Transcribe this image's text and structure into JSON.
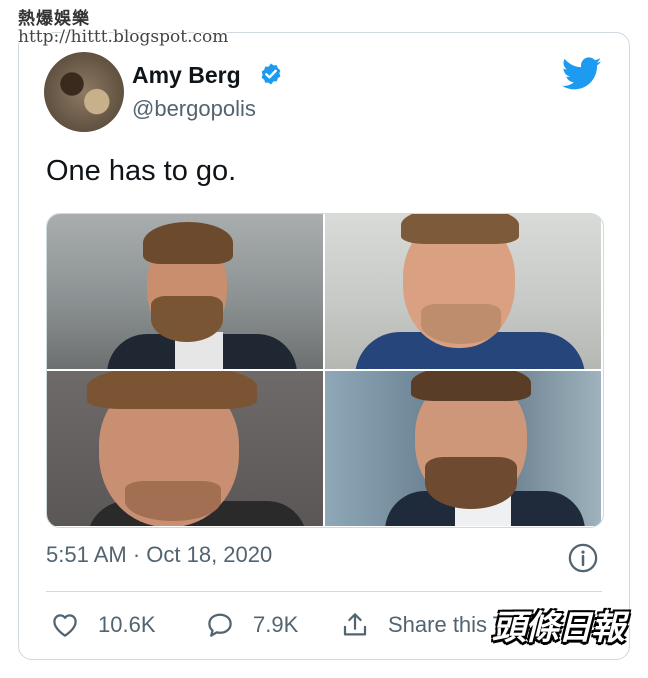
{
  "watermark": {
    "site_name": "熱爆娛樂",
    "site_url": "http://hittt.blogspot.com",
    "newspaper": "頭條日報"
  },
  "tweet": {
    "author_name": "Amy Berg",
    "handle": "@bergopolis",
    "text": "One has to go.",
    "timestamp": "5:51 AM · Oct 18, 2020",
    "verified": true,
    "accent_color": "#1d9bf0"
  },
  "actions": {
    "likes": "10.6K",
    "replies": "7.9K",
    "share_label": "Share this Tweet"
  },
  "icons": {
    "avatar": "avatar",
    "verified": "verified-badge-icon",
    "logo": "twitter-bird-icon",
    "info": "info-icon",
    "like": "heart-icon",
    "reply": "reply-bubble-icon",
    "share": "share-icon"
  }
}
